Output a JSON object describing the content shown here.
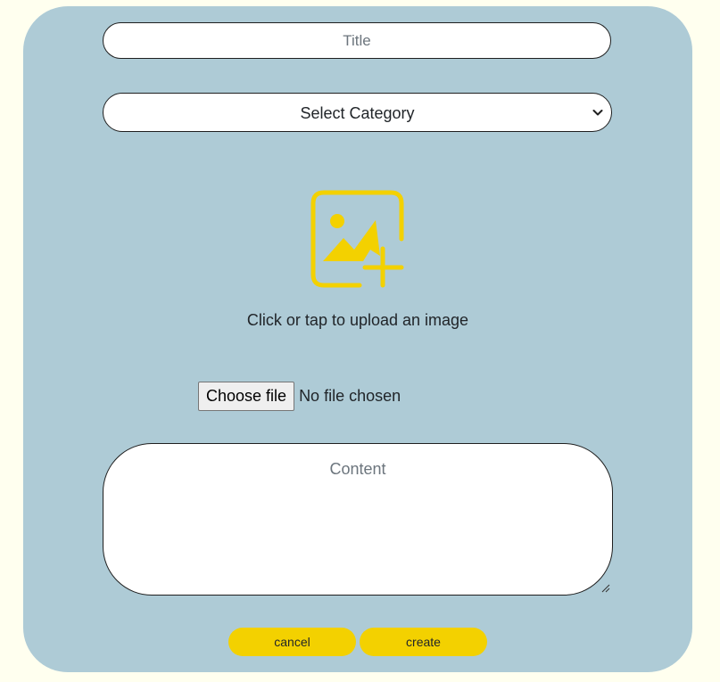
{
  "form": {
    "title_placeholder": "Title",
    "title_value": "",
    "category_selected": "Select Category",
    "upload_text": "Click or tap to upload an image",
    "file_button_label": "Choose file",
    "file_status": "No file chosen",
    "content_placeholder": "Content",
    "content_value": ""
  },
  "actions": {
    "cancel_label": "cancel",
    "create_label": "create"
  },
  "icons": {
    "upload": "add-image-icon",
    "select_arrow": "chevron-down-icon",
    "resize": "resize-handle-icon"
  },
  "colors": {
    "page_background": "#ffffef",
    "card_background": "#aecbd6",
    "accent": "#f3d100"
  }
}
